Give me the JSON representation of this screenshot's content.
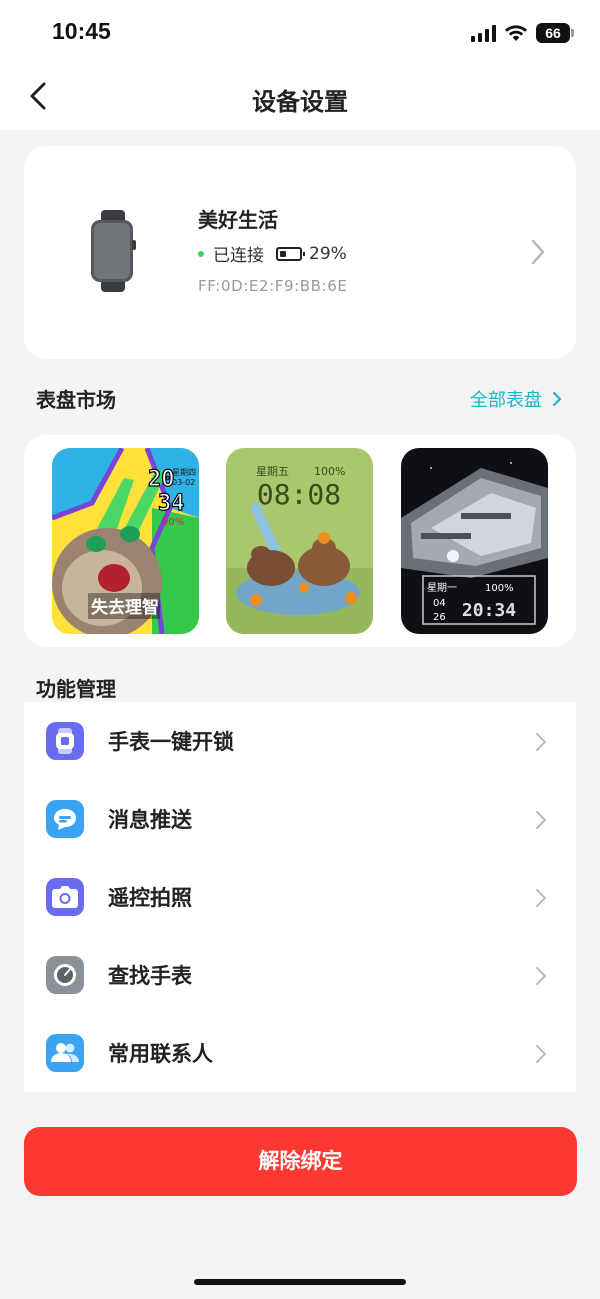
{
  "status_bar": {
    "time": "10:45",
    "battery": "66"
  },
  "header": {
    "title": "设备设置"
  },
  "device": {
    "name": "美好生活",
    "status": "已连接",
    "battery": "29%",
    "mac": "FF:0D:E2:F9:BB:6E"
  },
  "dial_market": {
    "title": "表盘市场",
    "all_link": "全部表盘",
    "faces": [
      {
        "name": "cat-face",
        "caption": "失去理智",
        "hour": "20",
        "minute": "34",
        "weekday": "星期四",
        "date": "03-02",
        "battery": "90%"
      },
      {
        "name": "capybara-face",
        "weekday": "星期五",
        "battery": "100%",
        "time": "08:08"
      },
      {
        "name": "spaceship-face",
        "weekday": "星期一",
        "battery": "100%",
        "month": "04",
        "day": "26",
        "time": "20:34"
      }
    ]
  },
  "functions": {
    "title": "功能管理",
    "items": [
      {
        "label": "手表一键开锁",
        "icon": "watch-unlock-icon",
        "color": "#6a6cf0"
      },
      {
        "label": "消息推送",
        "icon": "message-icon",
        "color": "#3aa3f2"
      },
      {
        "label": "遥控拍照",
        "icon": "camera-icon",
        "color": "#6a6cf0"
      },
      {
        "label": "查找手表",
        "icon": "find-watch-icon",
        "color": "#8c9097"
      },
      {
        "label": "常用联系人",
        "icon": "contacts-icon",
        "color": "#3aa3f2"
      }
    ]
  },
  "actions": {
    "unbind": "解除绑定"
  }
}
